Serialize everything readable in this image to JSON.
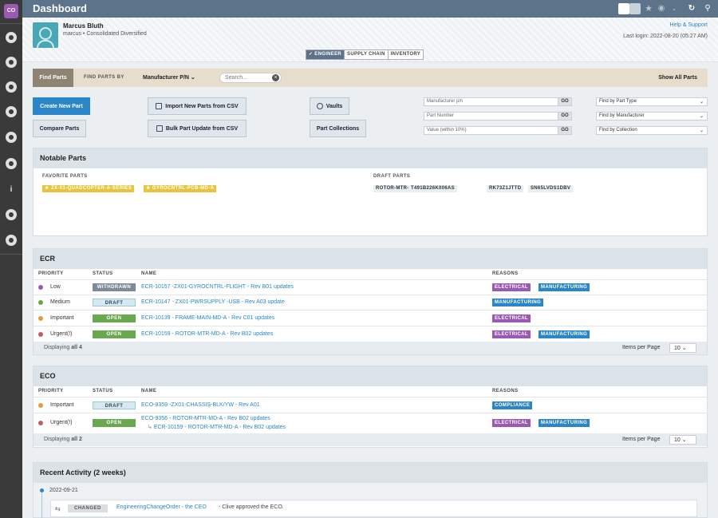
{
  "app": {
    "logo": "CO",
    "title": "Dashboard"
  },
  "sidebar": {
    "icons": [
      "dashboard-icon",
      "build-icon",
      "plus-circle-icon",
      "crosshair-icon",
      "arrow-left-icon",
      "upload-icon",
      "info-icon",
      "dollar-icon",
      "arrow-right-icon"
    ]
  },
  "topbar": {
    "icons": [
      "grid-view-icon",
      "list-view-icon",
      "star-icon",
      "eye-icon",
      "chevron-down-icon",
      "refresh-icon",
      "search-icon"
    ]
  },
  "user": {
    "name": "Marcus Bluth",
    "handle": "marcus",
    "sep": "•",
    "company": "Consolidated Diversified",
    "help": "Help & Support",
    "last_login": "Last login: 2022-08-20 (05:27 AM)"
  },
  "role_tabs": [
    {
      "label": "✓ ENGINEER"
    },
    {
      "label": "SUPPLY CHAIN"
    },
    {
      "label": "INVENTORY"
    }
  ],
  "find": {
    "button": "Find Parts",
    "by_label": "FIND PARTS BY",
    "selected": "Manufacturer P/N",
    "search_placeholder": "Search...",
    "show_all": "Show All Parts"
  },
  "actions": {
    "create": "Create New Part",
    "compare": "Compare Parts",
    "import": "Import New Parts from CSV",
    "bulk": "Bulk Part Update from CSV",
    "vaults": "Vaults",
    "collections": "Part Collections"
  },
  "quick": {
    "inputs": [
      {
        "placeholder": "Manufacturer p/n",
        "go": "GO"
      },
      {
        "placeholder": "Part Number",
        "go": "GO"
      },
      {
        "placeholder": "Value (within 10%)",
        "go": "GO"
      }
    ],
    "selects": [
      "Find by Part Type",
      "Find by Manufacturer",
      "Find by Collection"
    ]
  },
  "notable": {
    "title": "Notable Parts",
    "favorite_label": "FAVORITE PARTS",
    "favorites": [
      "ZX-01-QUADCOPTER-A-SERIES",
      "GYROCNTRL-PCB-MD-A"
    ],
    "draft_label": "DRAFT PARTS",
    "drafts": [
      "ROTOR-MTR-MD-A",
      "T491B226K006AS",
      "RK73Z1JTTD",
      "SN65LVDS1DBV"
    ]
  },
  "ecr": {
    "title": "ECR",
    "headers": {
      "priority": "PRIORITY",
      "status": "STATUS",
      "name": "NAME",
      "reasons": "REASONS"
    },
    "rows": [
      {
        "priority": "Low",
        "color": "#9b59b6",
        "status": "WITHDRAWN",
        "name": "ECR-10157 -ZX01-GYROCNTRL-FLIGHT - Rev B01 updates",
        "reasons": [
          "ELECTRICAL",
          "MANUFACTURING"
        ]
      },
      {
        "priority": "Medium",
        "color": "#6aa84f",
        "status": "DRAFT",
        "name": "ECR-10147 - ZX01-PWRSUPPLY -USB - Rev A03 update",
        "reasons": [
          "MANUFACTURING"
        ]
      },
      {
        "priority": "Important",
        "color": "#e69b3a",
        "status": "OPEN",
        "name": "ECR-10139 - FRAME-MAIN-MD-A - Rev C01 updates",
        "reasons": [
          "ELECTRICAL"
        ]
      },
      {
        "priority": "Urgent(!)",
        "color": "#c0605e",
        "status": "OPEN",
        "name": "ECR-10159 - ROTOR-MTR-MD-A - Rev B02 updates",
        "reasons": [
          "ELECTRICAL",
          "MANUFACTURING"
        ]
      }
    ],
    "displaying": "Displaying",
    "count": "all 4",
    "ipp_label": "Items per Page",
    "ipp": "10"
  },
  "eco": {
    "title": "ECO",
    "rows": [
      {
        "priority": "Important",
        "color": "#e69b3a",
        "status": "DRAFT",
        "name": "ECO-9359 -ZX01-CHASSIS-BLK/YW - Rev A01",
        "sub": "",
        "reasons": [
          "COMPLIANCE"
        ]
      },
      {
        "priority": "Urgent(!)",
        "color": "#c0605e",
        "status": "OPEN",
        "name": "ECO-9356 - ROTOR-MTR-MD-A - Rev B02 updates",
        "sub": "ECR-10159 - ROTOR-MTR-MD-A - Rev B02 updates",
        "reasons": [
          "ELECTRICAL",
          "MANUFACTURING"
        ]
      }
    ],
    "displaying": "Displaying",
    "count": "all 2",
    "ipp_label": "Items per Page",
    "ipp": "10"
  },
  "activity": {
    "title": "Recent Activity (2 weeks)",
    "date": "2022-09-21",
    "item": {
      "badge": "CHANGED",
      "link": "EngineeringChangeOrder - the CEO",
      "text": "- Clive approved the ECO."
    }
  }
}
